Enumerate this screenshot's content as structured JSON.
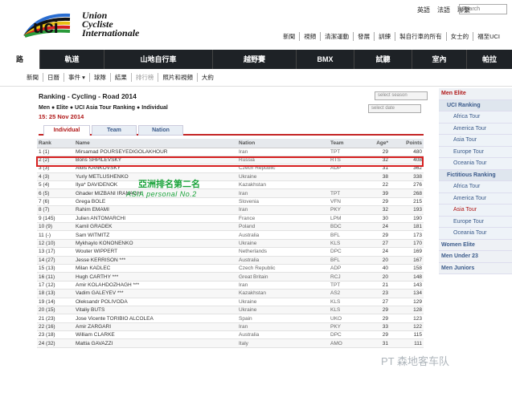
{
  "header": {
    "brand_lines": [
      "Union",
      "Cycliste",
      "Internationale"
    ],
    "lang_links": [
      "英語",
      "法語",
      "聯繫"
    ],
    "search_placeholder": "Search",
    "sub_links": [
      "新聞",
      "視頻",
      "清潔運動",
      "發展",
      "訓練",
      "製自行車的所有",
      "女士的",
      "福至UCI"
    ]
  },
  "nav": [
    "路",
    "軌道",
    "山地自行車",
    "越野賽",
    "BMX",
    "試聽",
    "室內",
    "帕拉"
  ],
  "subnav": [
    "新聞",
    "日曆",
    "事件 ▾",
    "球隊",
    "結果",
    "排行榜",
    "照片和視頻",
    "大約"
  ],
  "page": {
    "title": "Ranking - Cycling - Road 2014",
    "breadcrumb": "Men ● Elite ● UCI Asia Tour Ranking ● Individual",
    "date": "15: 25 Nov 2014",
    "select_season": "select season",
    "select_date": "select date",
    "tabs": [
      "Individual",
      "Team",
      "Nation"
    ]
  },
  "table": {
    "headers": [
      "Rank",
      "Name",
      "Nation",
      "Team",
      "Age*",
      "Points"
    ],
    "rows": [
      [
        "1 (1)",
        "Mirsamad POURSEYEDIGOLAKHOUR",
        "Iran",
        "TPT",
        "29",
        "480"
      ],
      [
        "2 (2)",
        "Boris SHPILEVSKY",
        "Russia",
        "RTS",
        "32",
        "408"
      ],
      [
        "3 (3)",
        "Alois KANKOVSKY",
        "Czech Republic",
        "ADP",
        "31",
        "362"
      ],
      [
        "4 (3)",
        "Yuriy METLUSHENKO",
        "Ukraine",
        "",
        "38",
        "338"
      ],
      [
        "5 (4)",
        "Ilya* DAVIDENOK",
        "Kazakhstan",
        "",
        "22",
        "276"
      ],
      [
        "6 (5)",
        "Ghader MIZBANI IRANAGH",
        "Iran",
        "TPT",
        "39",
        "268"
      ],
      [
        "7 (6)",
        "Grega BOLE",
        "Slovenia",
        "VFN",
        "29",
        "215"
      ],
      [
        "8 (7)",
        "Rahim EMAMI",
        "Iran",
        "PKY",
        "32",
        "193"
      ],
      [
        "9 (145)",
        "Julien ANTOMARCHI",
        "France",
        "LPM",
        "30",
        "190"
      ],
      [
        "10 (9)",
        "Kamil GRADEK",
        "Poland",
        "BDC",
        "24",
        "181"
      ],
      [
        "11 (-)",
        "Sam WITMITZ",
        "Australia",
        "BFL",
        "29",
        "173"
      ],
      [
        "12 (10)",
        "Mykhaylo KONONENKO",
        "Ukraine",
        "KLS",
        "27",
        "170"
      ],
      [
        "13 (17)",
        "Wouter WIPPERT",
        "Netherlands",
        "DPC",
        "24",
        "169"
      ],
      [
        "14 (27)",
        "Jesse KERRISON ***",
        "Australia",
        "BFL",
        "20",
        "167"
      ],
      [
        "15 (13)",
        "Milan KADLEC",
        "Czech Republic",
        "ADP",
        "40",
        "158"
      ],
      [
        "16 (11)",
        "Hugh CARTHY ***",
        "Great Britain",
        "RCJ",
        "20",
        "148"
      ],
      [
        "17 (12)",
        "Amir KOLAHDOZHAGH ***",
        "Iran",
        "TPT",
        "21",
        "143"
      ],
      [
        "18 (13)",
        "Vadim GALEYEV ***",
        "Kazakhstan",
        "AS2",
        "23",
        "134"
      ],
      [
        "19 (14)",
        "Oleksandr POLIVODA",
        "Ukraine",
        "KLS",
        "27",
        "129"
      ],
      [
        "20 (15)",
        "Vitaliy BUTS",
        "Ukraine",
        "KLS",
        "29",
        "128"
      ],
      [
        "21 (23)",
        "Jose Vicente TORIBIO ALCOLEA",
        "Spain",
        "UKO",
        "29",
        "123"
      ],
      [
        "22 (16)",
        "Amir ZARGARI",
        "Iran",
        "PKY",
        "33",
        "122"
      ],
      [
        "23 (18)",
        "William CLARKE",
        "Australia",
        "DPC",
        "29",
        "115"
      ],
      [
        "24 (32)",
        "Mattia GAVAZZI",
        "Italy",
        "AMO",
        "31",
        "111"
      ]
    ]
  },
  "annotation": {
    "zh": "亞洲排名第二名",
    "en": "ASIA personal No.2"
  },
  "sidebar": [
    {
      "kind": "h1",
      "label": "Men Elite"
    },
    {
      "kind": "h2",
      "label": "UCI Ranking"
    },
    {
      "kind": "it",
      "label": "Africa Tour"
    },
    {
      "kind": "it",
      "label": "America Tour"
    },
    {
      "kind": "it",
      "label": "Asia Tour"
    },
    {
      "kind": "it",
      "label": "Europe Tour"
    },
    {
      "kind": "it",
      "label": "Oceania Tour"
    },
    {
      "kind": "h2",
      "label": "Fictitious Ranking"
    },
    {
      "kind": "it",
      "label": "Africa Tour"
    },
    {
      "kind": "it",
      "label": "America Tour"
    },
    {
      "kind": "it on",
      "label": "Asia Tour"
    },
    {
      "kind": "it",
      "label": "Europe Tour"
    },
    {
      "kind": "it",
      "label": "Oceania Tour"
    },
    {
      "kind": "h3",
      "label": "Women Elite"
    },
    {
      "kind": "h3",
      "label": "Men Under 23"
    },
    {
      "kind": "h3",
      "label": "Men Juniors"
    }
  ],
  "watermark": "PT 森地客车队",
  "colors": {
    "accent": "#b01818",
    "nav_bg": "#1e2226",
    "highlight": "#d62020",
    "annotation": "#1aa33a"
  }
}
